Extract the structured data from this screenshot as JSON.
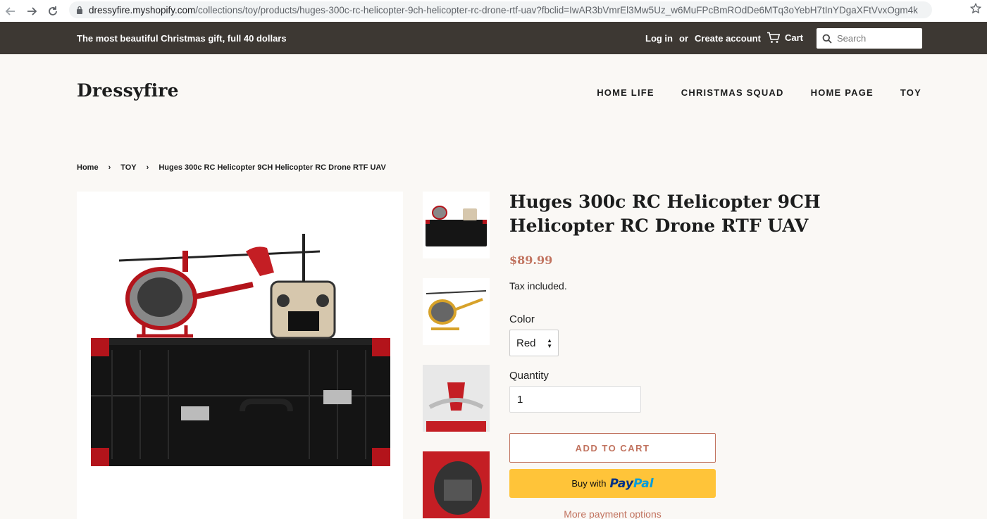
{
  "browser": {
    "url_host": "dressyfire.myshopify.com",
    "url_path": "/collections/toy/products/huges-300c-rc-helicopter-9ch-helicopter-rc-drone-rtf-uav?fbclid=IwAR3bVmrEl3Mw5Uz_w6MuFPcBmROdDe6MTq3oYebH7tInYDgaXFtVvxOgm4k"
  },
  "announcement": {
    "text": "The most beautiful Christmas gift, full 40 dollars",
    "login": "Log in",
    "or": "or",
    "create_account": "Create account",
    "cart": "Cart",
    "search_placeholder": "Search"
  },
  "header": {
    "logo": "Dressyfire",
    "nav": [
      "HOME LIFE",
      "CHRISTMAS SQUAD",
      "HOME PAGE",
      "TOY"
    ]
  },
  "breadcrumb": {
    "home": "Home",
    "sep": "›",
    "collection": "TOY",
    "current": "Huges 300c RC Helicopter 9CH Helicopter RC Drone RTF UAV"
  },
  "product": {
    "title": "Huges 300c RC Helicopter 9CH Helicopter RC Drone RTF UAV",
    "price": "$89.99",
    "tax_note": "Tax included.",
    "color_label": "Color",
    "color_value": "Red",
    "quantity_label": "Quantity",
    "quantity_value": "1",
    "add_to_cart": "ADD TO CART",
    "paypal_prefix": "Buy with",
    "paypal_brand_a": "Pay",
    "paypal_brand_b": "Pal",
    "more_payment": "More payment options"
  },
  "colors": {
    "topbar": "#3d3833",
    "accent": "#c1735f",
    "paypal_yellow": "#ffc439",
    "background": "#faf8f5"
  }
}
